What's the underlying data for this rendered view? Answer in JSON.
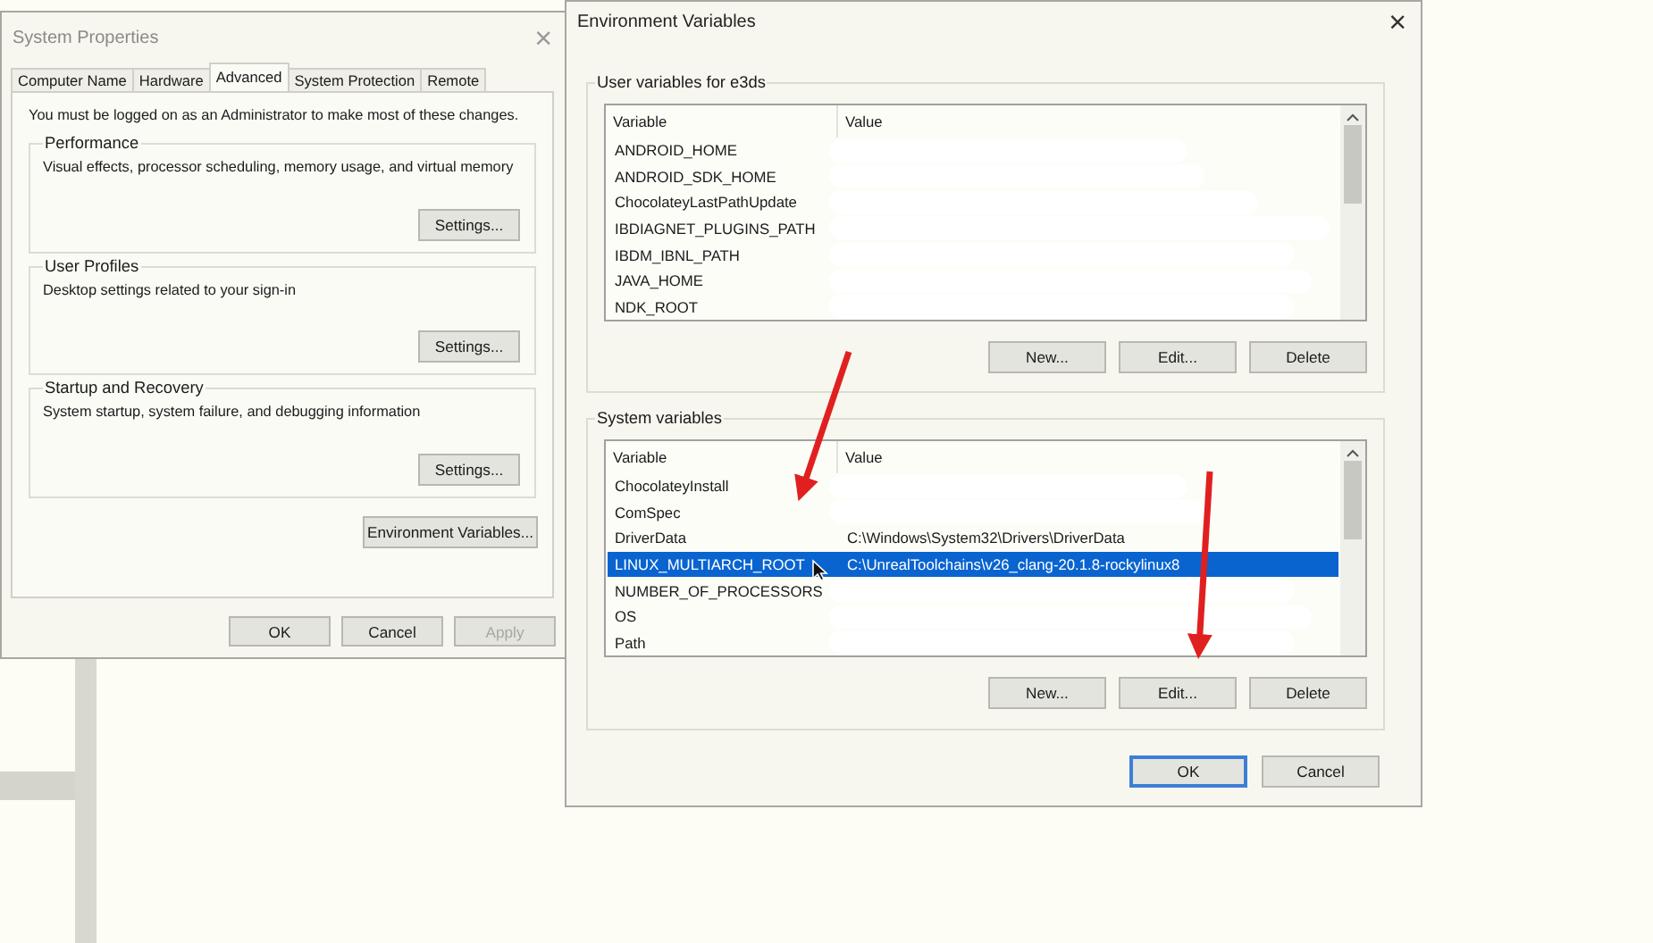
{
  "system_properties": {
    "title": "System Properties",
    "close": "×",
    "tabs": [
      {
        "label": "Computer Name",
        "selected": false
      },
      {
        "label": "Hardware",
        "selected": false
      },
      {
        "label": "Advanced",
        "selected": true
      },
      {
        "label": "System Protection",
        "selected": false
      },
      {
        "label": "Remote",
        "selected": false
      }
    ],
    "admin_note": "You must be logged on as an Administrator to make most of these changes.",
    "groups": [
      {
        "title": "Performance",
        "description": "Visual effects, processor scheduling, memory usage, and virtual memory",
        "button": "Settings..."
      },
      {
        "title": "User Profiles",
        "description": "Desktop settings related to your sign-in",
        "button": "Settings..."
      },
      {
        "title": "Startup and Recovery",
        "description": "System startup, system failure, and debugging information",
        "button": "Settings..."
      }
    ],
    "env_button": "Environment Variables...",
    "footer_buttons": [
      {
        "label": "OK",
        "disabled": false
      },
      {
        "label": "Cancel",
        "disabled": false
      },
      {
        "label": "Apply",
        "disabled": true
      }
    ]
  },
  "environment_variables": {
    "title": "Environment Variables",
    "close": "×",
    "sections": [
      {
        "title": "User variables for e3ds",
        "columns": [
          "Variable",
          "Value"
        ],
        "rows": [
          {
            "variable": "ANDROID_HOME",
            "selected": false
          },
          {
            "variable": "ANDROID_SDK_HOME",
            "selected": false
          },
          {
            "variable": "ChocolateyLastPathUpdate",
            "selected": false
          },
          {
            "variable": "IBDIAGNET_PLUGINS_PATH",
            "selected": false
          },
          {
            "variable": "IBDM_IBNL_PATH",
            "selected": false
          },
          {
            "variable": "JAVA_HOME",
            "selected": false
          },
          {
            "variable": "NDK_ROOT",
            "selected": false
          }
        ],
        "buttons": [
          "New...",
          "Edit...",
          "Delete"
        ]
      },
      {
        "title": "System variables",
        "columns": [
          "Variable",
          "Value"
        ],
        "rows": [
          {
            "variable": "ChocolateyInstall",
            "selected": false
          },
          {
            "variable": "ComSpec",
            "selected": false
          },
          {
            "variable": "DriverData",
            "value": "C:\\Windows\\System32\\Drivers\\DriverData",
            "selected": false
          },
          {
            "variable": "LINUX_MULTIARCH_ROOT",
            "value": "C:\\UnrealToolchains\\v26_clang-20.1.8-rockylinux8",
            "selected": true
          },
          {
            "variable": "NUMBER_OF_PROCESSORS",
            "selected": false
          },
          {
            "variable": "OS",
            "selected": false
          },
          {
            "variable": "Path",
            "selected": false
          }
        ],
        "buttons": [
          "New...",
          "Edit...",
          "Delete"
        ]
      }
    ],
    "footer_buttons": [
      {
        "label": "OK",
        "focused": true
      },
      {
        "label": "Cancel",
        "focused": false
      }
    ]
  }
}
